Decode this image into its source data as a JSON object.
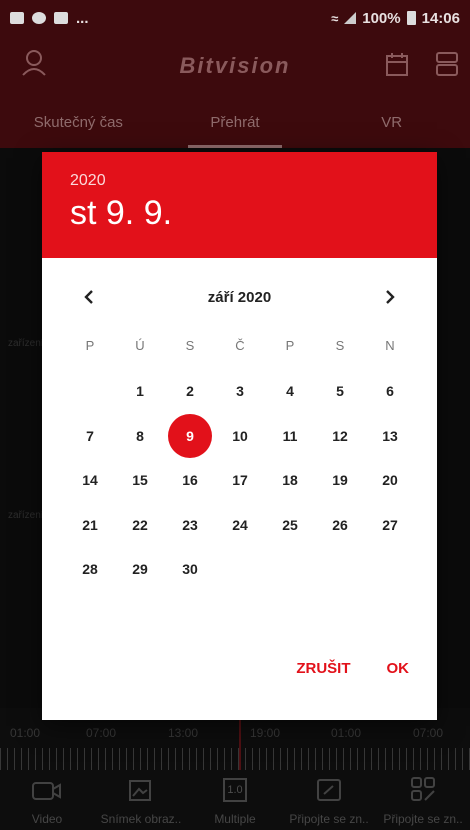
{
  "status_bar": {
    "battery": "100%",
    "time": "14:06",
    "more": "..."
  },
  "app": {
    "brand": "Bitvision",
    "tabs": [
      "Skutečný čas",
      "Přehrát",
      "VR"
    ],
    "active_tab": 1
  },
  "background": {
    "row_label_1": "zařízení",
    "row_label_2": "zařízení"
  },
  "timeline": {
    "times": [
      "01:00",
      "07:00",
      "13:00",
      "19:00",
      "01:00",
      "07:00"
    ]
  },
  "bottom_bar": {
    "items": [
      "Video",
      "Snímek obraz..",
      "Multiple",
      "Připojte se zn..",
      "Připojte se zn.."
    ],
    "multiple_badge": "1.0"
  },
  "dialog": {
    "year": "2020",
    "selected_date": "st 9. 9.",
    "month_label": "září 2020",
    "weekdays": [
      "P",
      "Ú",
      "S",
      "Č",
      "P",
      "S",
      "N"
    ],
    "leading_blanks": 1,
    "days_in_month": 30,
    "selected_day": 9,
    "cancel_label": "ZRUŠIT",
    "ok_label": "OK"
  },
  "colors": {
    "accent": "#e2111a",
    "header_dark": "#3d0a0d"
  }
}
